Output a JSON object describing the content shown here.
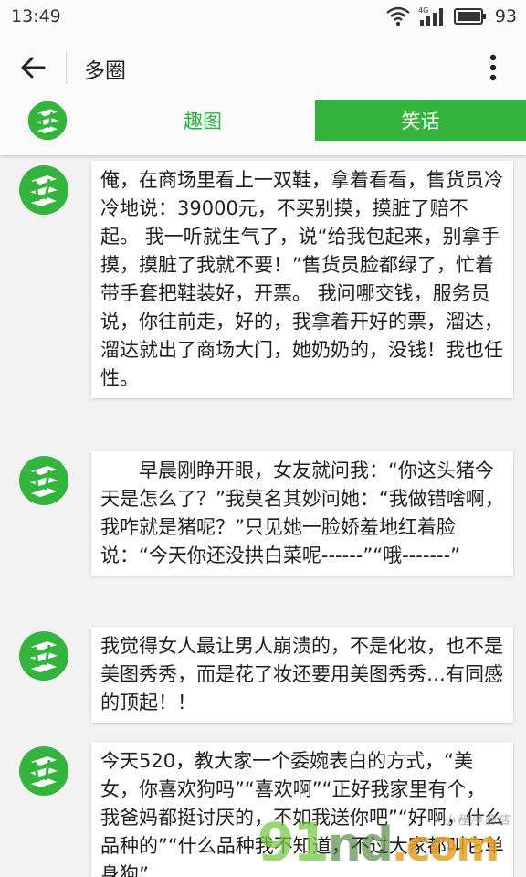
{
  "status_bar": {
    "time": "13:49",
    "network_label": "4G",
    "battery_level": "93"
  },
  "toolbar": {
    "title": "多圈"
  },
  "tabs": {
    "fun_label": "趣图",
    "joke_label": "笑话",
    "active": "笑话"
  },
  "colors": {
    "brand_green": "#33b53d",
    "tab_text_green": "#2db33f"
  },
  "jokes": [
    {
      "text": "俺，在商场里看上一双鞋，拿着看看，售货员冷冷地说：39000元，不买别摸，摸脏了赔不起。 我一听就生气了，说“给我包起来，别拿手摸，摸脏了我就不要！”售货员脸都绿了，忙着带手套把鞋装好，开票。 我问哪交钱，服务员说，你往前走，好的，我拿着开好的票，溜达，溜达就出了商场大门，她奶奶的，没钱！我也任性。"
    },
    {
      "text": "早晨刚睁开眼，女友就问我：“你这头猪今天是怎么了？”我莫名其妙问她：“我做错啥啊，我咋就是猪呢？”只见她一脸娇羞地红着脸说：“今天你还没拱白菜呢------”“哦-------”"
    },
    {
      "text": "我觉得女人最让男人崩溃的，不是化妆，也不是美图秀秀，而是花了妆还要用美图秀秀…有同感的顶起！！"
    },
    {
      "text": "今天520，教大家一个委婉表白的方式，“美女，你喜欢狗吗”“喜欢啊”“正好我家里有个，我爸妈都挺讨厌的，不如我送你吧”“好啊，什么品种的”“什么品种我不知道，不过大家都叫它单身狗”"
    }
  ],
  "watermark": {
    "digits": "9",
    "num": "1",
    "tail": "nd",
    "domain": ".com",
    "small": "小程序商店"
  }
}
